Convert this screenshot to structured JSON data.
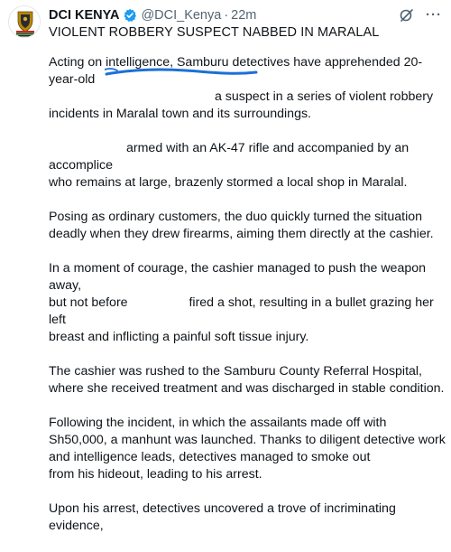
{
  "tweet": {
    "author_name": "DCI KENYA",
    "handle": "@DCI_Kenya",
    "dot": "·",
    "time": "22m",
    "headline": "VIOLENT ROBBERY SUSPECT NABBED IN MARALAL",
    "more": "···",
    "paragraphs": {
      "p1a": "Acting on intelligence, Samburu detectives have apprehended 20-year-old",
      "p1b": "a suspect in a series of violent robbery",
      "p1c": "incidents in Maralal town and its surroundings.",
      "p2a": "armed with an AK-47 rifle and accompanied by an accomplice",
      "p2b": "who remains at large, brazenly stormed a local shop in Maralal.",
      "p3": "Posing as ordinary customers, the duo quickly turned the situation deadly when they drew firearms, aiming them directly at the cashier.",
      "p4a": "In a moment of courage, the cashier managed to push the weapon away,",
      "p4b": "but not before",
      "p4c": "fired a shot, resulting in a bullet grazing her left",
      "p4d": "breast and inflicting a painful soft tissue injury.",
      "p5": "The cashier was rushed to the Samburu County Referral Hospital, where she received treatment and was discharged in stable condition.",
      "p6a": "Following the incident, in which the assailants made off with Sh50,000, a manhunt was launched. Thanks to diligent detective work and intelligence leads, detectives managed to smoke out",
      "p6b": "from his hideout, leading to his arrest.",
      "p7": "Upon his arrest, detectives uncovered a trove of incriminating evidence,"
    }
  },
  "icons": {
    "verified": "verified-badge-icon",
    "grok": "grok-icon",
    "more": "more-icon",
    "avatar": "dci-logo"
  },
  "colors": {
    "verified_blue": "#1d9bf0",
    "muted": "#536471",
    "text": "#0f1419",
    "scribble": "#1d6fd8"
  }
}
